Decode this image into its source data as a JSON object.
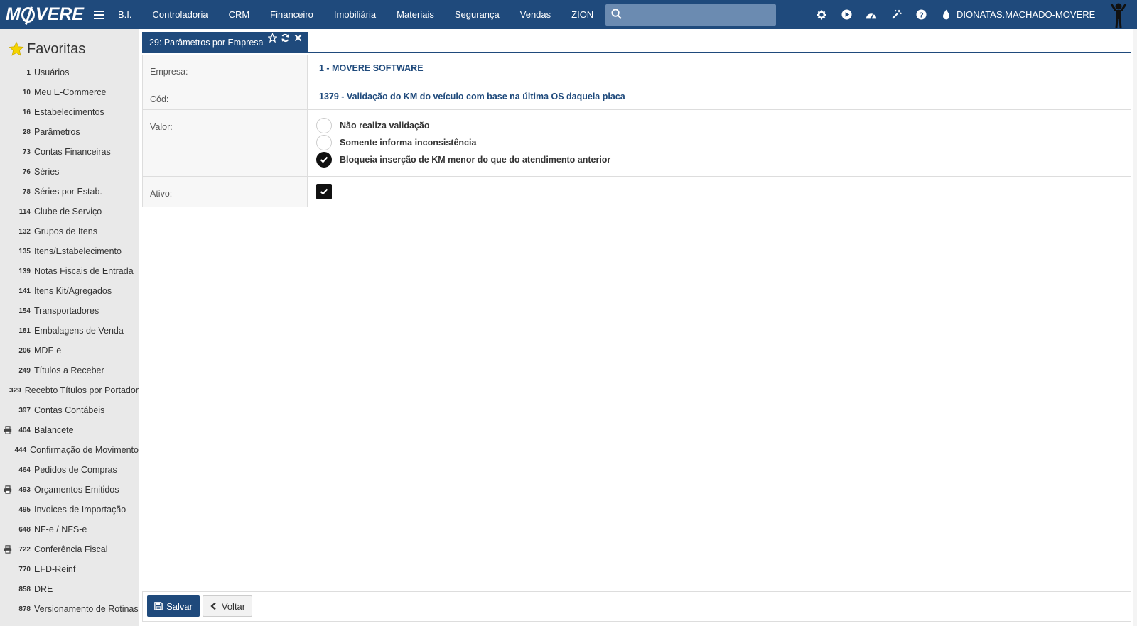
{
  "app": {
    "brand": "MOVERE",
    "menu": [
      "B.I.",
      "Controladoria",
      "CRM",
      "Financeiro",
      "Imobiliária",
      "Materiais",
      "Segurança",
      "Vendas",
      "ZION"
    ],
    "search_placeholder": "",
    "username": "DIONATAS.MACHADO-MOVERE",
    "top_icons": [
      "gear-icon",
      "play-icon",
      "dashboard-icon",
      "magic-wand-icon",
      "help-icon",
      "drop-icon"
    ]
  },
  "sidebar": {
    "title": "Favoritas",
    "items": [
      {
        "num": "1",
        "label": "Usuários",
        "print": false
      },
      {
        "num": "10",
        "label": "Meu E-Commerce",
        "print": false
      },
      {
        "num": "16",
        "label": "Estabelecimentos",
        "print": false
      },
      {
        "num": "28",
        "label": "Parâmetros",
        "print": false
      },
      {
        "num": "73",
        "label": "Contas Financeiras",
        "print": false
      },
      {
        "num": "76",
        "label": "Séries",
        "print": false
      },
      {
        "num": "78",
        "label": "Séries por Estab.",
        "print": false
      },
      {
        "num": "114",
        "label": "Clube de Serviço",
        "print": false
      },
      {
        "num": "132",
        "label": "Grupos de Itens",
        "print": false
      },
      {
        "num": "135",
        "label": "Itens/Estabelecimento",
        "print": false
      },
      {
        "num": "139",
        "label": "Notas Fiscais de Entrada",
        "print": false
      },
      {
        "num": "141",
        "label": "Itens Kit/Agregados",
        "print": false
      },
      {
        "num": "154",
        "label": "Transportadores",
        "print": false
      },
      {
        "num": "181",
        "label": "Embalagens de Venda",
        "print": false
      },
      {
        "num": "206",
        "label": "MDF-e",
        "print": false
      },
      {
        "num": "249",
        "label": "Títulos a Receber",
        "print": false
      },
      {
        "num": "329",
        "label": "Recebto Títulos por Portador",
        "print": false
      },
      {
        "num": "397",
        "label": "Contas Contábeis",
        "print": false
      },
      {
        "num": "404",
        "label": "Balancete",
        "print": true
      },
      {
        "num": "444",
        "label": "Confirmação de Movimento",
        "print": false
      },
      {
        "num": "464",
        "label": "Pedidos de Compras",
        "print": false
      },
      {
        "num": "493",
        "label": "Orçamentos Emitidos",
        "print": true
      },
      {
        "num": "495",
        "label": "Invoices de Importação",
        "print": false
      },
      {
        "num": "648",
        "label": "NF-e / NFS-e",
        "print": false
      },
      {
        "num": "722",
        "label": "Conferência Fiscal",
        "print": true
      },
      {
        "num": "770",
        "label": "EFD-Reinf",
        "print": false
      },
      {
        "num": "858",
        "label": "DRE",
        "print": false
      },
      {
        "num": "878",
        "label": "Versionamento de Rotinas",
        "print": false
      },
      {
        "num": "",
        "label": "",
        "print": false
      }
    ]
  },
  "tab": {
    "label": "29: Parâmetros por Empresa"
  },
  "form": {
    "empresa_label": "Empresa:",
    "empresa_value": "1 - MOVERE SOFTWARE",
    "cod_label": "Cód:",
    "cod_value": "1379 - Validação do KM do veículo com base na última OS daquela placa",
    "valor_label": "Valor:",
    "valor_options": [
      {
        "label": "Não realiza validação",
        "checked": false
      },
      {
        "label": "Somente informa inconsistência",
        "checked": false
      },
      {
        "label": "Bloqueia inserção de KM menor do que do atendimento anterior",
        "checked": true
      }
    ],
    "ativo_label": "Ativo:",
    "ativo_checked": true
  },
  "footer": {
    "save_label": "Salvar",
    "back_label": "Voltar"
  },
  "colors": {
    "primary": "#1f4a7c",
    "sidebar_bg": "#e9e9e9",
    "search_bg": "#6b8bb1"
  }
}
